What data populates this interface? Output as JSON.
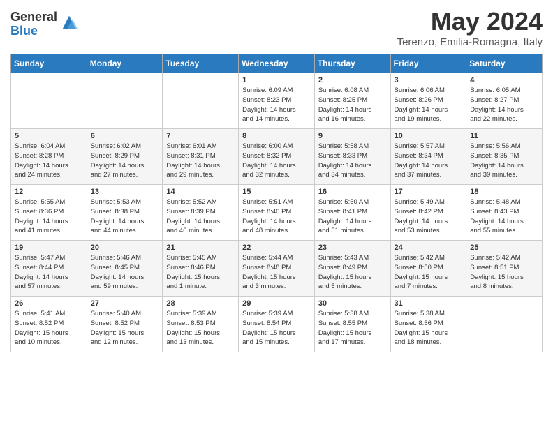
{
  "logo": {
    "general": "General",
    "blue": "Blue"
  },
  "title": "May 2024",
  "location": "Terenzo, Emilia-Romagna, Italy",
  "days_of_week": [
    "Sunday",
    "Monday",
    "Tuesday",
    "Wednesday",
    "Thursday",
    "Friday",
    "Saturday"
  ],
  "weeks": [
    [
      {
        "day": "",
        "info": ""
      },
      {
        "day": "",
        "info": ""
      },
      {
        "day": "",
        "info": ""
      },
      {
        "day": "1",
        "info": "Sunrise: 6:09 AM\nSunset: 8:23 PM\nDaylight: 14 hours\nand 14 minutes."
      },
      {
        "day": "2",
        "info": "Sunrise: 6:08 AM\nSunset: 8:25 PM\nDaylight: 14 hours\nand 16 minutes."
      },
      {
        "day": "3",
        "info": "Sunrise: 6:06 AM\nSunset: 8:26 PM\nDaylight: 14 hours\nand 19 minutes."
      },
      {
        "day": "4",
        "info": "Sunrise: 6:05 AM\nSunset: 8:27 PM\nDaylight: 14 hours\nand 22 minutes."
      }
    ],
    [
      {
        "day": "5",
        "info": "Sunrise: 6:04 AM\nSunset: 8:28 PM\nDaylight: 14 hours\nand 24 minutes."
      },
      {
        "day": "6",
        "info": "Sunrise: 6:02 AM\nSunset: 8:29 PM\nDaylight: 14 hours\nand 27 minutes."
      },
      {
        "day": "7",
        "info": "Sunrise: 6:01 AM\nSunset: 8:31 PM\nDaylight: 14 hours\nand 29 minutes."
      },
      {
        "day": "8",
        "info": "Sunrise: 6:00 AM\nSunset: 8:32 PM\nDaylight: 14 hours\nand 32 minutes."
      },
      {
        "day": "9",
        "info": "Sunrise: 5:58 AM\nSunset: 8:33 PM\nDaylight: 14 hours\nand 34 minutes."
      },
      {
        "day": "10",
        "info": "Sunrise: 5:57 AM\nSunset: 8:34 PM\nDaylight: 14 hours\nand 37 minutes."
      },
      {
        "day": "11",
        "info": "Sunrise: 5:56 AM\nSunset: 8:35 PM\nDaylight: 14 hours\nand 39 minutes."
      }
    ],
    [
      {
        "day": "12",
        "info": "Sunrise: 5:55 AM\nSunset: 8:36 PM\nDaylight: 14 hours\nand 41 minutes."
      },
      {
        "day": "13",
        "info": "Sunrise: 5:53 AM\nSunset: 8:38 PM\nDaylight: 14 hours\nand 44 minutes."
      },
      {
        "day": "14",
        "info": "Sunrise: 5:52 AM\nSunset: 8:39 PM\nDaylight: 14 hours\nand 46 minutes."
      },
      {
        "day": "15",
        "info": "Sunrise: 5:51 AM\nSunset: 8:40 PM\nDaylight: 14 hours\nand 48 minutes."
      },
      {
        "day": "16",
        "info": "Sunrise: 5:50 AM\nSunset: 8:41 PM\nDaylight: 14 hours\nand 51 minutes."
      },
      {
        "day": "17",
        "info": "Sunrise: 5:49 AM\nSunset: 8:42 PM\nDaylight: 14 hours\nand 53 minutes."
      },
      {
        "day": "18",
        "info": "Sunrise: 5:48 AM\nSunset: 8:43 PM\nDaylight: 14 hours\nand 55 minutes."
      }
    ],
    [
      {
        "day": "19",
        "info": "Sunrise: 5:47 AM\nSunset: 8:44 PM\nDaylight: 14 hours\nand 57 minutes."
      },
      {
        "day": "20",
        "info": "Sunrise: 5:46 AM\nSunset: 8:45 PM\nDaylight: 14 hours\nand 59 minutes."
      },
      {
        "day": "21",
        "info": "Sunrise: 5:45 AM\nSunset: 8:46 PM\nDaylight: 15 hours\nand 1 minute."
      },
      {
        "day": "22",
        "info": "Sunrise: 5:44 AM\nSunset: 8:48 PM\nDaylight: 15 hours\nand 3 minutes."
      },
      {
        "day": "23",
        "info": "Sunrise: 5:43 AM\nSunset: 8:49 PM\nDaylight: 15 hours\nand 5 minutes."
      },
      {
        "day": "24",
        "info": "Sunrise: 5:42 AM\nSunset: 8:50 PM\nDaylight: 15 hours\nand 7 minutes."
      },
      {
        "day": "25",
        "info": "Sunrise: 5:42 AM\nSunset: 8:51 PM\nDaylight: 15 hours\nand 8 minutes."
      }
    ],
    [
      {
        "day": "26",
        "info": "Sunrise: 5:41 AM\nSunset: 8:52 PM\nDaylight: 15 hours\nand 10 minutes."
      },
      {
        "day": "27",
        "info": "Sunrise: 5:40 AM\nSunset: 8:52 PM\nDaylight: 15 hours\nand 12 minutes."
      },
      {
        "day": "28",
        "info": "Sunrise: 5:39 AM\nSunset: 8:53 PM\nDaylight: 15 hours\nand 13 minutes."
      },
      {
        "day": "29",
        "info": "Sunrise: 5:39 AM\nSunset: 8:54 PM\nDaylight: 15 hours\nand 15 minutes."
      },
      {
        "day": "30",
        "info": "Sunrise: 5:38 AM\nSunset: 8:55 PM\nDaylight: 15 hours\nand 17 minutes."
      },
      {
        "day": "31",
        "info": "Sunrise: 5:38 AM\nSunset: 8:56 PM\nDaylight: 15 hours\nand 18 minutes."
      },
      {
        "day": "",
        "info": ""
      }
    ]
  ]
}
